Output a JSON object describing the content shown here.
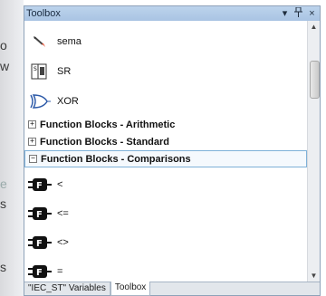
{
  "panel": {
    "title": "Toolbox"
  },
  "titlebar": {
    "buttons": [
      "▾",
      "ꟷ",
      "×"
    ]
  },
  "background_fragments": [
    "o",
    "w",
    "e",
    "s",
    "s"
  ],
  "items": [
    {
      "label": "sema",
      "icon": "pencil-icon"
    },
    {
      "label": "SR",
      "icon": "sr-block-icon"
    },
    {
      "label": "XOR",
      "icon": "xor-gate-icon"
    }
  ],
  "categories": [
    {
      "label": "Function Blocks - Arithmetic",
      "expander": "+"
    },
    {
      "label": "Function Blocks - Standard",
      "expander": "+"
    },
    {
      "label": "Function Blocks - Comparisons",
      "expander": "−"
    }
  ],
  "comparison_items": [
    {
      "label": "<"
    },
    {
      "label": "<="
    },
    {
      "label": "<>"
    },
    {
      "label": "="
    }
  ],
  "comparison_icon_text": "F",
  "tabs": [
    "\"IEC_ST\" Variables",
    "Toolbox"
  ]
}
